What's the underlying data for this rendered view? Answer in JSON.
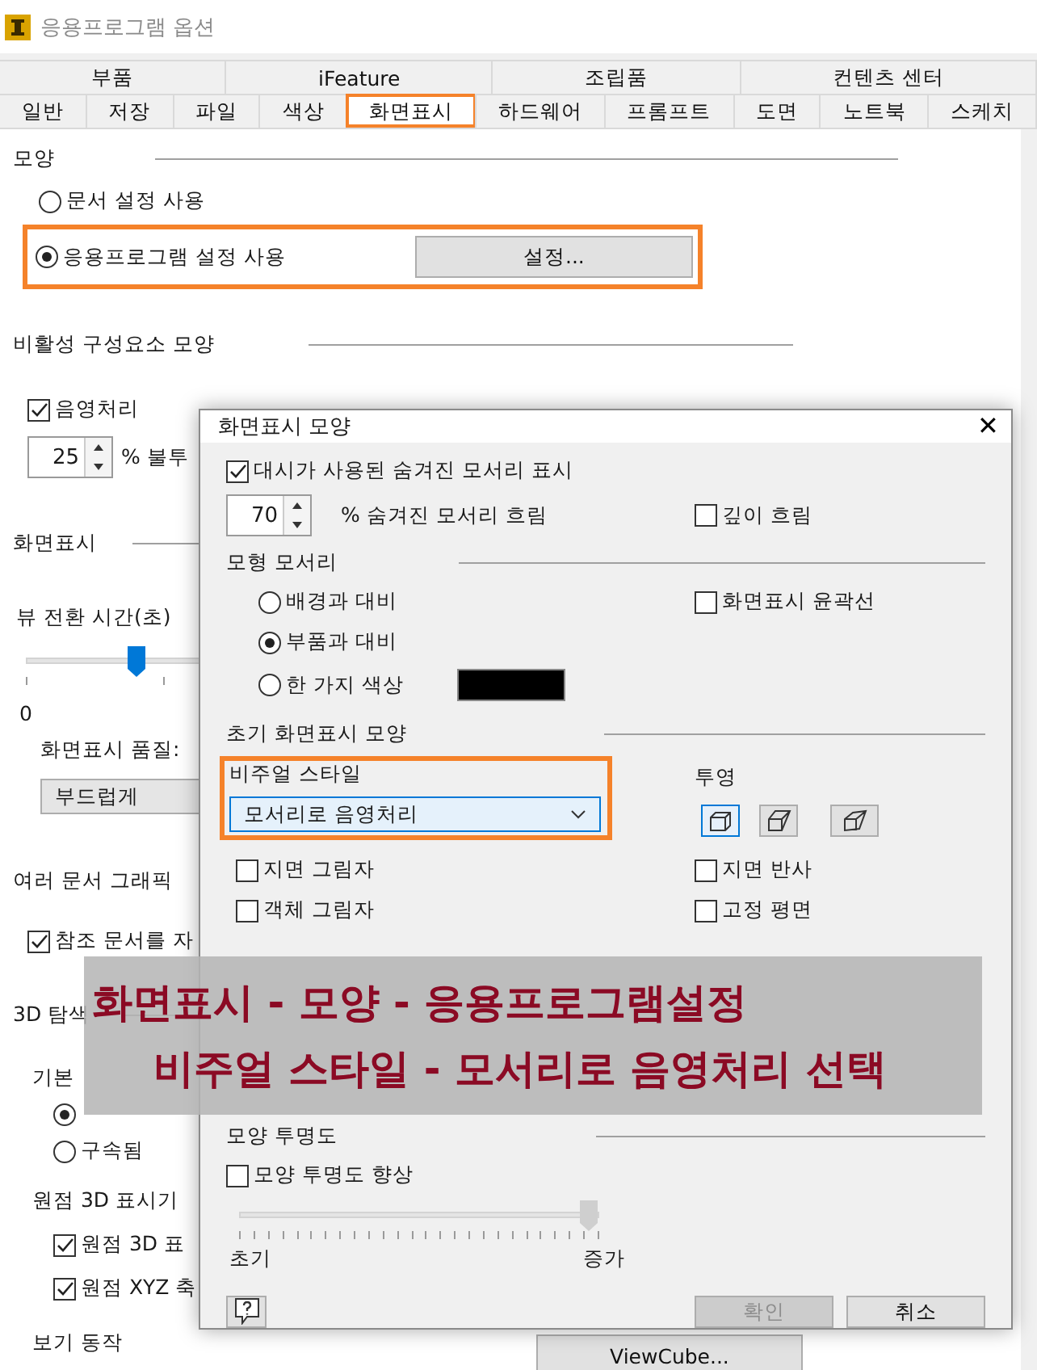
{
  "window": {
    "title": "응용프로그램 옵션"
  },
  "tab_rows": [
    {
      "tabs": [
        {
          "label": "부품",
          "selected": false,
          "highlighted": false
        },
        {
          "label": "iFeature",
          "selected": false,
          "highlighted": false
        },
        {
          "label": "조립품",
          "selected": false,
          "highlighted": false
        },
        {
          "label": "컨텐츠 센터",
          "selected": false,
          "highlighted": false
        }
      ]
    },
    {
      "tabs": [
        {
          "label": "일반",
          "selected": false,
          "highlighted": false
        },
        {
          "label": "저장",
          "selected": false,
          "highlighted": false
        },
        {
          "label": "파일",
          "selected": false,
          "highlighted": false
        },
        {
          "label": "색상",
          "selected": false,
          "highlighted": false
        },
        {
          "label": "화면표시",
          "selected": true,
          "highlighted": true
        },
        {
          "label": "하드웨어",
          "selected": false,
          "highlighted": false
        },
        {
          "label": "프롬프트",
          "selected": false,
          "highlighted": false
        },
        {
          "label": "도면",
          "selected": false,
          "highlighted": false
        },
        {
          "label": "노트북",
          "selected": false,
          "highlighted": false
        },
        {
          "label": "스케치",
          "selected": false,
          "highlighted": false
        }
      ]
    }
  ],
  "appearance": {
    "heading": "모양",
    "options": [
      {
        "label": "문서 설정 사용",
        "selected": false,
        "highlighted": false
      },
      {
        "label": "응용프로그램 설정 사용",
        "selected": true,
        "highlighted": true
      }
    ],
    "button": "설정..."
  },
  "inactive": {
    "heading": "비활성 구성요소 모양",
    "shading": {
      "label": "음영처리",
      "checked": true
    },
    "opacity": {
      "value": "25",
      "label": "% 불투"
    }
  },
  "display": {
    "heading": "화면표시",
    "transition": {
      "label": "뷰 전환 시간(초)",
      "level": 0.16,
      "min": "0"
    },
    "quality": {
      "label": "화면표시 품질:",
      "value": "부드럽게"
    }
  },
  "multi_doc": {
    "heading": "여러 문서 그래픽",
    "auto": {
      "label": "참조 문서를 자",
      "checked": true
    }
  },
  "navigation": {
    "heading": "3D 탐색",
    "sub": "기본",
    "radios": [
      {
        "selected": true
      },
      {
        "label": "구속됨",
        "selected": false
      }
    ]
  },
  "origin": {
    "heading": "원점 3D 표시기",
    "checks": [
      {
        "label": "원점 3D 표",
        "checked": true
      },
      {
        "label": "원점 XYZ 축",
        "checked": true
      }
    ]
  },
  "view": {
    "heading": "보기 동작",
    "button": "ViewCube..."
  },
  "dialog": {
    "title": "화면표시 모양",
    "close": "✕",
    "hidden_edges": {
      "label": "대시가 사용된 숨겨진 모서리 표시",
      "checked": true
    },
    "dim": {
      "value": "70",
      "label": "% 숨겨진 모서리 흐림"
    },
    "depth_dim": {
      "label": "깊이 흐림",
      "checked": false
    },
    "model_edges": {
      "heading": "모형 모서리",
      "radios": [
        {
          "label": "배경과 대비",
          "selected": false
        },
        {
          "label": "부품과 대비",
          "selected": true
        },
        {
          "label": "한 가지 색상",
          "selected": false
        }
      ],
      "silhouette": {
        "label": "화면표시 윤곽선",
        "checked": false
      }
    },
    "initial": {
      "heading": "초기 화면표시 모양",
      "visual_style": {
        "label": "비주얼 스타일",
        "value": "모서리로 음영처리",
        "highlighted": true
      },
      "projection": {
        "label": "투영",
        "options": [
          {
            "kind": "orthographic",
            "selected": true
          },
          {
            "kind": "perspective",
            "selected": false
          },
          {
            "kind": "mixed",
            "selected": false
          }
        ]
      },
      "left_checks": [
        {
          "label": "지면 그림자",
          "checked": false
        },
        {
          "label": "객체 그림자",
          "checked": false
        }
      ],
      "right_checks": [
        {
          "label": "지면 반사",
          "checked": false
        },
        {
          "label": "고정 평면",
          "checked": false
        }
      ]
    },
    "transparency": {
      "heading": "모양 투명도",
      "enhance": {
        "label": "모양 투명도 향상",
        "checked": false
      },
      "slider": {
        "level": 1,
        "min": "초기",
        "max": "증가"
      }
    },
    "buttons": [
      {
        "label": "확인",
        "disabled": true
      },
      {
        "label": "취소",
        "disabled": false
      }
    ]
  },
  "caption": {
    "lines": [
      "화면표시 - 모양 - 응용프로그램설정",
      "비주얼 스타일 - 모서리로 음영처리 선택"
    ]
  }
}
